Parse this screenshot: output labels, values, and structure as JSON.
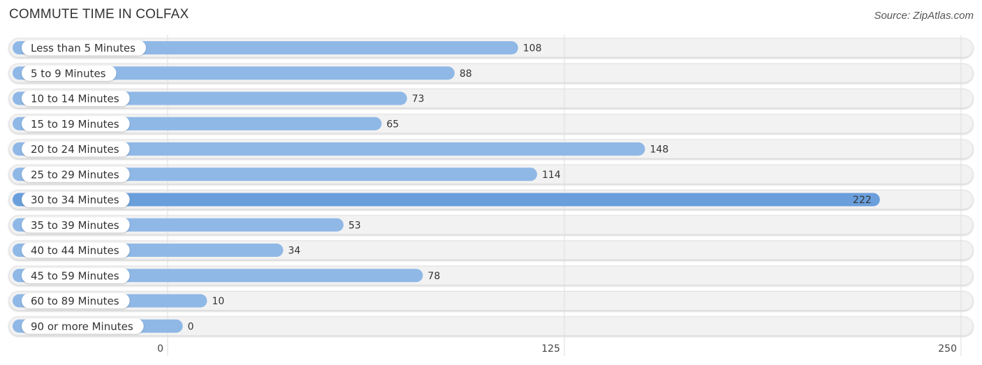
{
  "header": {
    "title": "COMMUTE TIME IN COLFAX",
    "source": "Source: ZipAtlas.com"
  },
  "colors": {
    "bar": "#8fb8e6",
    "bar_highlight": "#6a9fdc",
    "track": "#f2f2f2",
    "label_bg": "#ffffff"
  },
  "chart_data": {
    "type": "bar",
    "orientation": "horizontal",
    "title": "COMMUTE TIME IN COLFAX",
    "categories": [
      "Less than 5 Minutes",
      "5 to 9 Minutes",
      "10 to 14 Minutes",
      "15 to 19 Minutes",
      "20 to 24 Minutes",
      "25 to 29 Minutes",
      "30 to 34 Minutes",
      "35 to 39 Minutes",
      "40 to 44 Minutes",
      "45 to 59 Minutes",
      "60 to 89 Minutes",
      "90 or more Minutes"
    ],
    "values": [
      108,
      88,
      73,
      65,
      148,
      114,
      222,
      53,
      34,
      78,
      10,
      0
    ],
    "xlim": [
      0,
      250
    ],
    "xticks": [
      0,
      125,
      250
    ],
    "xtick_labels": [
      "0",
      "125",
      "250"
    ],
    "xlabel": "",
    "ylabel": "",
    "grid": true,
    "highlight_index": 6
  }
}
